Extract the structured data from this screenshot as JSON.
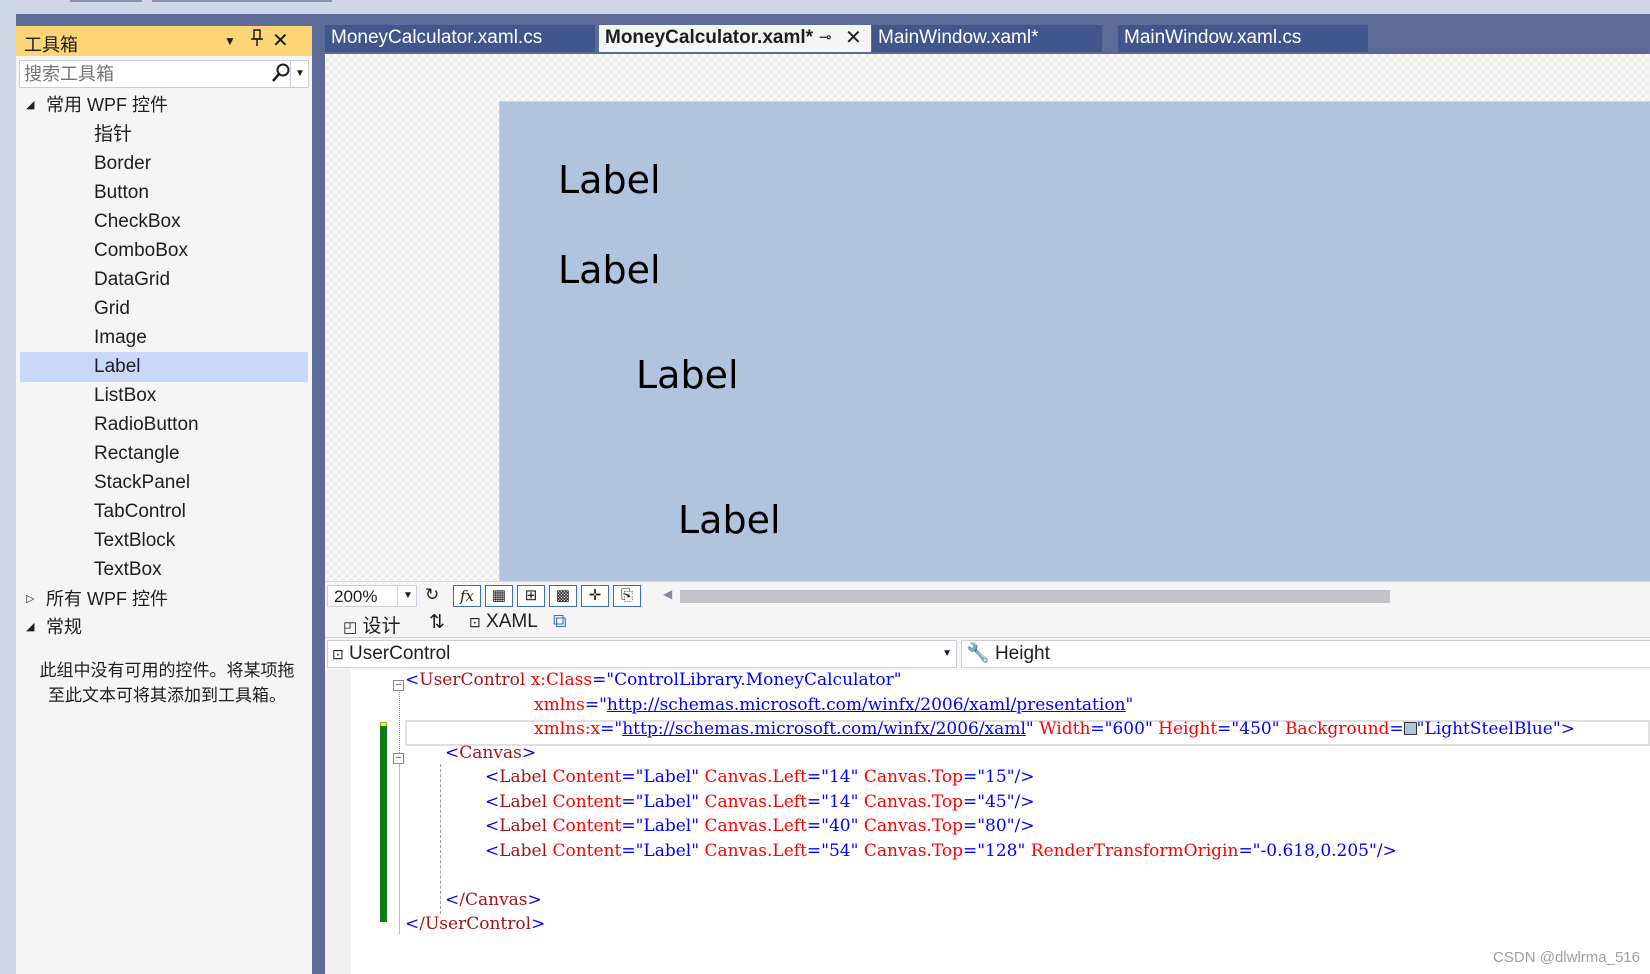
{
  "toolbox": {
    "title": "工具箱",
    "search_placeholder": "搜索工具箱",
    "groups": [
      {
        "label": "常用 WPF 控件",
        "expanded": true
      },
      {
        "label": "所有 WPF 控件",
        "expanded": false
      },
      {
        "label": "常规",
        "expanded": true
      }
    ],
    "items": [
      "指针",
      "Border",
      "Button",
      "CheckBox",
      "ComboBox",
      "DataGrid",
      "Grid",
      "Image",
      "Label",
      "ListBox",
      "RadioButton",
      "Rectangle",
      "StackPanel",
      "TabControl",
      "TextBlock",
      "TextBox"
    ],
    "selected_item": "Label",
    "empty_message_line1": "此组中没有可用的控件。将某项拖",
    "empty_message_line2": "至此文本可将其添加到工具箱。"
  },
  "tabs": [
    {
      "label": "MoneyCalculator.xaml.cs",
      "active": false
    },
    {
      "label": "MoneyCalculator.xaml*",
      "active": true
    },
    {
      "label": "MainWindow.xaml*",
      "active": false
    },
    {
      "label": "MainWindow.xaml.cs",
      "active": false
    }
  ],
  "designer": {
    "labels": [
      "Label",
      "Label",
      "Label",
      "Label"
    ],
    "background": "#b0c4de"
  },
  "zoombar": {
    "zoom": "200%"
  },
  "viewbar": {
    "design_tab": "设计",
    "xaml_tab": "XAML"
  },
  "dropdowns": {
    "element": "UserControl",
    "property": "Height"
  },
  "code": {
    "l1": {
      "tag": "UserControl",
      "attr": "x:Class",
      "val": "ControlLibrary.MoneyCalculator"
    },
    "l2": {
      "attr": "xmlns",
      "val": "http://schemas.microsoft.com/winfx/2006/xaml/presentation"
    },
    "l3": {
      "attr": "xmlns:x",
      "val": "http://schemas.microsoft.com/winfx/2006/xaml",
      "w_attr": "Width",
      "w_val": "600",
      "h_attr": "Height",
      "h_val": "450",
      "bg_attr": "Background",
      "bg_val": "LightSteelBlue"
    },
    "canvas": "Canvas",
    "labels": [
      {
        "content": "Label",
        "left": "14",
        "top": "15"
      },
      {
        "content": "Label",
        "left": "14",
        "top": "45"
      },
      {
        "content": "Label",
        "left": "40",
        "top": "80"
      },
      {
        "content": "Label",
        "left": "54",
        "top": "128",
        "origin": "-0.618,0.205"
      }
    ],
    "close_canvas": "/Canvas",
    "close_uc": "/UserControl"
  },
  "watermark": "CSDN @dlwlrma_516",
  "colors": {
    "accent_header": "#fdd577",
    "tab_active_bg": "#f5f5f5",
    "tab_bg": "#40568d",
    "frame": "#5d6b99"
  }
}
